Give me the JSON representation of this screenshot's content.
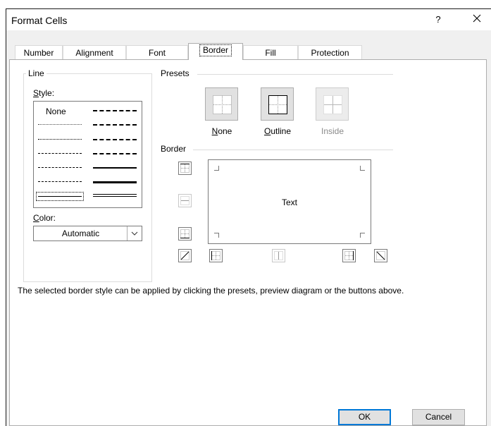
{
  "window": {
    "title": "Format Cells",
    "help_glyph": "?",
    "close_glyph": "×"
  },
  "tabs": [
    {
      "label": "Number"
    },
    {
      "label": "Alignment"
    },
    {
      "label": "Font"
    },
    {
      "label": "Border",
      "active": true
    },
    {
      "label": "Fill"
    },
    {
      "label": "Protection"
    }
  ],
  "line_group": {
    "title": "Line",
    "style_label_prefix": "S",
    "style_label_rest": "tyle:",
    "none_option": "None",
    "color_label_prefix": "C",
    "color_label_rest": "olor:",
    "color_value": "Automatic"
  },
  "presets": {
    "title": "Presets",
    "none_prefix": "N",
    "none_rest": "one",
    "outline_prefix": "O",
    "outline_rest": "utline",
    "inside_label": "Inside"
  },
  "border": {
    "title": "Border",
    "preview_text": "Text"
  },
  "help_text": "The selected border style can be applied by clicking the presets, preview diagram or the buttons above.",
  "buttons": {
    "ok": "OK",
    "cancel": "Cancel"
  },
  "colors": {
    "focus_border": "#0078d7",
    "button_face": "#e1e1e1",
    "disabled_text": "#8a8a8a"
  }
}
